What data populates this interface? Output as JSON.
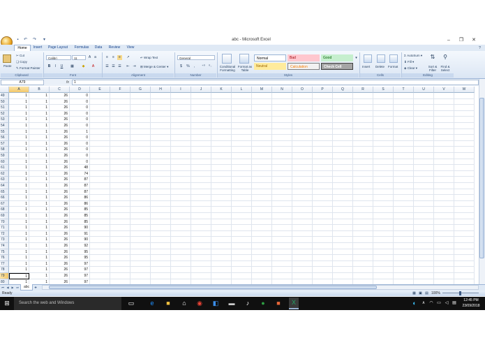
{
  "window": {
    "title": "abc - Microsoft Excel",
    "qat_icons": [
      "save-icon",
      "undo-icon",
      "redo-icon",
      "customize-qat-icon"
    ]
  },
  "tabs": [
    "Home",
    "Insert",
    "Page Layout",
    "Formulas",
    "Data",
    "Review",
    "View"
  ],
  "ribbon": {
    "clipboard": {
      "paste": "Paste",
      "cut": "Cut",
      "copy": "Copy",
      "format_painter": "Format Painter",
      "label": "Clipboard"
    },
    "font": {
      "name": "Calibri",
      "size": "11",
      "label": "Font"
    },
    "alignment": {
      "wrap": "Wrap Text",
      "merge": "Merge & Center",
      "label": "Alignment"
    },
    "number": {
      "format": "General",
      "symbols": [
        "$",
        "%",
        ","
      ],
      "label": "Number"
    },
    "styles": {
      "conditional": "Conditional Formatting",
      "format_table": "Format as Table",
      "cells": [
        {
          "label": "Normal",
          "bg": "#ffffff",
          "fg": "#000000"
        },
        {
          "label": "Bad",
          "bg": "#ffc7ce",
          "fg": "#9c0006"
        },
        {
          "label": "Good",
          "bg": "#c6efce",
          "fg": "#006100"
        },
        {
          "label": "Neutral",
          "bg": "#ffeb9c",
          "fg": "#9c6500"
        },
        {
          "label": "Calculation",
          "bg": "#f2f2f2",
          "fg": "#fa7d00"
        },
        {
          "label": "Check Cell",
          "bg": "#a5a5a5",
          "fg": "#ffffff"
        }
      ],
      "label": "Styles"
    },
    "cells": {
      "insert": "Insert",
      "delete": "Delete",
      "format": "Format",
      "label": "Cells"
    },
    "editing": {
      "autosum": "AutoSum",
      "fill": "Fill",
      "clear": "Clear",
      "sort": "Sort & Filter",
      "find": "Find & Select",
      "label": "Editing"
    }
  },
  "formula_bar": {
    "name_box": "A79",
    "fx": "fx",
    "value": "1"
  },
  "columns": [
    "A",
    "B",
    "C",
    "D",
    "E",
    "F",
    "G",
    "H",
    "I",
    "J",
    "K",
    "L",
    "M",
    "N",
    "O",
    "P",
    "Q",
    "R",
    "S",
    "T",
    "U",
    "V",
    "W"
  ],
  "rows": [
    {
      "n": "49",
      "v": [
        "1",
        "1",
        "26",
        "0"
      ]
    },
    {
      "n": "50",
      "v": [
        "1",
        "1",
        "26",
        "0"
      ]
    },
    {
      "n": "51",
      "v": [
        "1",
        "1",
        "26",
        "0"
      ]
    },
    {
      "n": "52",
      "v": [
        "1",
        "1",
        "26",
        "0"
      ]
    },
    {
      "n": "53",
      "v": [
        "1",
        "1",
        "26",
        "0"
      ]
    },
    {
      "n": "54",
      "v": [
        "1",
        "1",
        "26",
        "0"
      ]
    },
    {
      "n": "55",
      "v": [
        "1",
        "1",
        "26",
        "1"
      ]
    },
    {
      "n": "56",
      "v": [
        "1",
        "1",
        "26",
        "0"
      ]
    },
    {
      "n": "57",
      "v": [
        "1",
        "1",
        "26",
        "0"
      ]
    },
    {
      "n": "58",
      "v": [
        "1",
        "1",
        "26",
        "0"
      ]
    },
    {
      "n": "59",
      "v": [
        "1",
        "1",
        "26",
        "0"
      ]
    },
    {
      "n": "60",
      "v": [
        "1",
        "1",
        "26",
        "0"
      ]
    },
    {
      "n": "61",
      "v": [
        "1",
        "1",
        "26",
        "48"
      ]
    },
    {
      "n": "62",
      "v": [
        "1",
        "1",
        "26",
        "74"
      ]
    },
    {
      "n": "63",
      "v": [
        "1",
        "1",
        "26",
        "87"
      ]
    },
    {
      "n": "64",
      "v": [
        "1",
        "1",
        "26",
        "87"
      ]
    },
    {
      "n": "65",
      "v": [
        "1",
        "1",
        "26",
        "87"
      ]
    },
    {
      "n": "66",
      "v": [
        "1",
        "1",
        "26",
        "86"
      ]
    },
    {
      "n": "67",
      "v": [
        "1",
        "1",
        "26",
        "86"
      ]
    },
    {
      "n": "68",
      "v": [
        "1",
        "1",
        "26",
        "85"
      ]
    },
    {
      "n": "69",
      "v": [
        "1",
        "1",
        "26",
        "85"
      ]
    },
    {
      "n": "70",
      "v": [
        "1",
        "1",
        "26",
        "85"
      ]
    },
    {
      "n": "71",
      "v": [
        "1",
        "1",
        "26",
        "90"
      ]
    },
    {
      "n": "72",
      "v": [
        "1",
        "1",
        "26",
        "91"
      ]
    },
    {
      "n": "73",
      "v": [
        "1",
        "1",
        "26",
        "90"
      ]
    },
    {
      "n": "74",
      "v": [
        "1",
        "1",
        "26",
        "92"
      ]
    },
    {
      "n": "75",
      "v": [
        "1",
        "1",
        "26",
        "95"
      ]
    },
    {
      "n": "76",
      "v": [
        "1",
        "1",
        "26",
        "95"
      ]
    },
    {
      "n": "77",
      "v": [
        "1",
        "1",
        "26",
        "97"
      ]
    },
    {
      "n": "78",
      "v": [
        "1",
        "1",
        "26",
        "97"
      ]
    },
    {
      "n": "79",
      "v": [
        "1",
        "1",
        "26",
        "97"
      ]
    },
    {
      "n": "80",
      "v": [
        "1",
        "1",
        "26",
        "97"
      ]
    }
  ],
  "selected": {
    "row": "79",
    "col": "A"
  },
  "sheet": {
    "tab": "abc"
  },
  "status": {
    "text": "Ready",
    "zoom": "100%"
  },
  "taskbar": {
    "search_placeholder": "Search the web and Windows",
    "time": "12:45 PM",
    "date": "23/09/2018"
  }
}
